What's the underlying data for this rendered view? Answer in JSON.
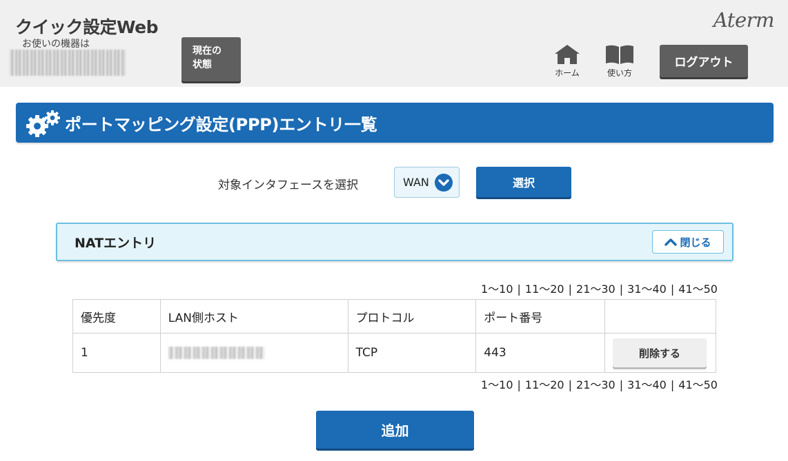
{
  "header": {
    "app_title": "クイック設定Web",
    "device_label": "お使いの機器は",
    "status_button": "現在の\n状態",
    "brand": "Aterm",
    "nav": [
      {
        "label": "ホーム",
        "icon": "home-icon"
      },
      {
        "label": "使い方",
        "icon": "book-icon"
      }
    ],
    "logout_label": "ログアウト"
  },
  "page": {
    "title": "ポートマッピング設定(PPP)エントリ一覧",
    "icon": "gear-icon"
  },
  "interface": {
    "label": "対象インタフェースを選択",
    "selected": "WAN",
    "select_button": "選択"
  },
  "nat_panel": {
    "title": "NATエントリ",
    "close_label": "閉じる"
  },
  "pagination": [
    "1〜10",
    "11〜20",
    "21〜30",
    "31〜40",
    "41〜50"
  ],
  "table": {
    "columns": [
      "優先度",
      "LAN側ホスト",
      "プロトコル",
      "ポート番号",
      ""
    ],
    "rows": [
      {
        "priority": "1",
        "protocol": "TCP",
        "port": "443",
        "action": "削除する"
      }
    ]
  },
  "add_label": "追加",
  "colors": {
    "primary": "#1b6bb5",
    "panel_bg": "#e4f4fb",
    "panel_border": "#6cbfe2",
    "header_bg": "#f0f0f0",
    "dark_button": "#5f5f5f"
  }
}
